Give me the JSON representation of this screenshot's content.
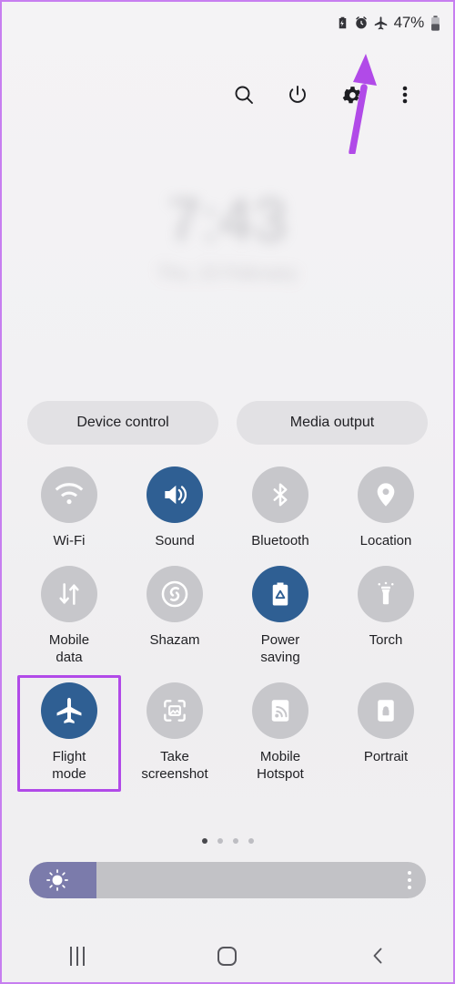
{
  "status_bar": {
    "icons": [
      "power-saving-icon",
      "alarm-icon",
      "airplane-icon"
    ],
    "battery_percent": "47%"
  },
  "toolbar": {
    "buttons": [
      {
        "name": "search-icon",
        "label": "Search"
      },
      {
        "name": "power-icon",
        "label": "Power"
      },
      {
        "name": "settings-gear-icon",
        "label": "Settings"
      },
      {
        "name": "more-options-icon",
        "label": "More options"
      }
    ]
  },
  "clock": {
    "time": "7:43",
    "date": "Thu, 23 February"
  },
  "pills": [
    {
      "label": "Device control"
    },
    {
      "label": "Media output"
    }
  ],
  "tiles": [
    [
      {
        "label": "Wi-Fi",
        "icon": "wifi-icon",
        "state": "off"
      },
      {
        "label": "Sound",
        "icon": "sound-icon",
        "state": "on"
      },
      {
        "label": "Bluetooth",
        "icon": "bluetooth-icon",
        "state": "off"
      },
      {
        "label": "Location",
        "icon": "location-pin-icon",
        "state": "off"
      }
    ],
    [
      {
        "label": "Mobile\ndata",
        "icon": "mobile-data-icon",
        "state": "off"
      },
      {
        "label": "Shazam",
        "icon": "shazam-icon",
        "state": "off"
      },
      {
        "label": "Power\nsaving",
        "icon": "power-saving-battery-icon",
        "state": "on"
      },
      {
        "label": "Torch",
        "icon": "torch-icon",
        "state": "off"
      }
    ],
    [
      {
        "label": "Flight\nmode",
        "icon": "airplane-icon",
        "state": "on",
        "highlighted": true
      },
      {
        "label": "Take\nscreenshot",
        "icon": "screenshot-icon",
        "state": "off"
      },
      {
        "label": "Mobile\nHotspot",
        "icon": "hotspot-icon",
        "state": "off"
      },
      {
        "label": "Portrait",
        "icon": "screen-lock-rotation-icon",
        "state": "off"
      }
    ]
  ],
  "page_dots": {
    "count": 4,
    "active_index": 0
  },
  "brightness": {
    "level_percent": 17,
    "icon": "brightness-sun-icon",
    "menu_icon": "brightness-options-icon"
  },
  "nav_bar": [
    {
      "name": "recents-button",
      "label": "Recents"
    },
    {
      "name": "home-button",
      "label": "Home"
    },
    {
      "name": "back-button",
      "label": "Back"
    }
  ],
  "annotation": {
    "type": "arrow",
    "color": "#b14ae8",
    "points_to": "airplane-icon"
  },
  "highlight": {
    "color": "#b14ae8",
    "target": "Flight mode"
  }
}
